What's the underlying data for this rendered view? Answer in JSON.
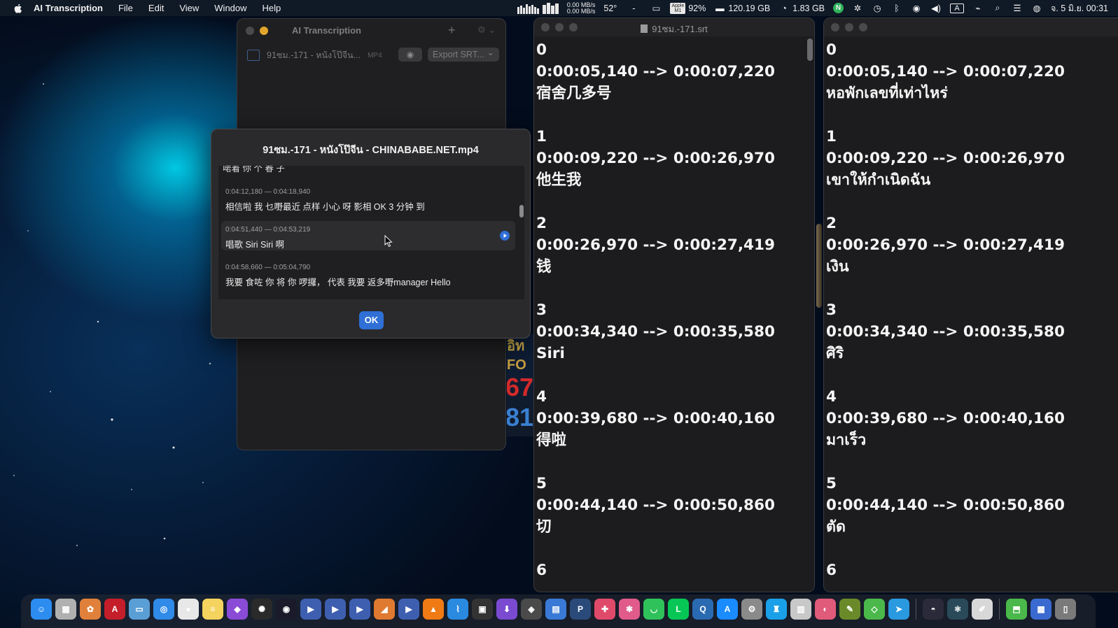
{
  "menubar": {
    "app_name": "AI Transcription",
    "menus": [
      "File",
      "Edit",
      "View",
      "Window",
      "Help"
    ],
    "net_up": "0.00 MB/s",
    "net_down": "0.00 MB/s",
    "temperature": "52°",
    "dash": "-",
    "chip_label_1": "Apple",
    "chip_label_2": "M1",
    "cpu_percent": "92%",
    "disk_free": "120.19 GB",
    "memory": "1.83 GB",
    "input_source": "A",
    "datetime": "จ. 5 มิ.ย.  00:31"
  },
  "main_window": {
    "title": "AI Transcription",
    "add_symbol": "+",
    "file_name": "91ซม.-171 - หนังโป๊จีน...",
    "file_type": "MP4",
    "export_label": "Export SRT...",
    "export_chevron": "⌄"
  },
  "dialog": {
    "title": "91ซม.-171 - หนังโป๊จีน - CHINABABE.NET.mp4",
    "cut_text": "啱着 你 个 春 子",
    "segments": [
      {
        "time": "0:04:12,180 — 0:04:18,940",
        "text": "相信啦 我 乜嘢最近 点样 小心 呀 影相 OK 3 分钟 到"
      },
      {
        "time": "0:04:51,440 — 0:04:53,219",
        "text": "唱歌 Siri Siri 啊"
      },
      {
        "time": "0:04:58,660 — 0:05:04,790",
        "text": "我要 食咗 你 将 你 啰攞， 代表 我要 返多嘢manager Hello"
      }
    ],
    "ok_label": "OK"
  },
  "behind_window": {
    "text_1": "อิท",
    "text_2": "FO",
    "text_3": "67",
    "text_4": "81"
  },
  "srt_left": {
    "title": "91ซม.-171.srt",
    "entries": [
      {
        "index": "0",
        "time": "0:00:05,140 --> 0:00:07,220",
        "text": "宿舍几多号"
      },
      {
        "index": "1",
        "time": "0:00:09,220 --> 0:00:26,970",
        "text": "他生我"
      },
      {
        "index": "2",
        "time": "0:00:26,970 --> 0:00:27,419",
        "text": "钱"
      },
      {
        "index": "3",
        "time": "0:00:34,340 --> 0:00:35,580",
        "text": "Siri"
      },
      {
        "index": "4",
        "time": "0:00:39,680 --> 0:00:40,160",
        "text": "得啦"
      },
      {
        "index": "5",
        "time": "0:00:44,140 --> 0:00:50,860",
        "text": "切"
      },
      {
        "index": "6",
        "time": "",
        "text": ""
      }
    ]
  },
  "srt_right": {
    "entries": [
      {
        "index": "0",
        "time": "0:00:05,140 --> 0:00:07,220",
        "text": "หอพักเลขที่เท่าไหร่"
      },
      {
        "index": "1",
        "time": "0:00:09,220 --> 0:00:26,970",
        "text": "เขาให้กำเนิดฉัน"
      },
      {
        "index": "2",
        "time": "0:00:26,970 --> 0:00:27,419",
        "text": "เงิน"
      },
      {
        "index": "3",
        "time": "0:00:34,340 --> 0:00:35,580",
        "text": "ศิริ"
      },
      {
        "index": "4",
        "time": "0:00:39,680 --> 0:00:40,160",
        "text": "มาเร็ว"
      },
      {
        "index": "5",
        "time": "0:00:44,140 --> 0:00:50,860",
        "text": "ตัด"
      },
      {
        "index": "6",
        "time": "",
        "text": ""
      }
    ]
  },
  "dock": {
    "apps": [
      {
        "name": "finder-icon",
        "color": "#2d8cf0",
        "glyph": "☺"
      },
      {
        "name": "launchpad-icon",
        "color": "#b0b0b0",
        "glyph": "▦"
      },
      {
        "name": "photos-icon",
        "color": "#e0803a",
        "glyph": "✿"
      },
      {
        "name": "adobe-icon",
        "color": "#c41e2a",
        "glyph": "A"
      },
      {
        "name": "preview-icon",
        "color": "#5a9ed6",
        "glyph": "▭"
      },
      {
        "name": "safari-icon",
        "color": "#2f8ae8",
        "glyph": "◎"
      },
      {
        "name": "chrome-icon",
        "color": "#e8e8e8",
        "glyph": "●"
      },
      {
        "name": "notes-icon",
        "color": "#f4d35e",
        "glyph": "≡"
      },
      {
        "name": "affinity-icon",
        "color": "#8a4bd6",
        "glyph": "◆"
      },
      {
        "name": "davinci-icon",
        "color": "#2a2a2a",
        "glyph": "✺"
      },
      {
        "name": "hitfilm-icon",
        "color": "#1a1a2a",
        "glyph": "◉"
      },
      {
        "name": "player-1-icon",
        "color": "#3e5fb0",
        "glyph": "▶"
      },
      {
        "name": "player-2-icon",
        "color": "#3e5fb0",
        "glyph": "▶"
      },
      {
        "name": "player-3-icon",
        "color": "#3e5fb0",
        "glyph": "▶"
      },
      {
        "name": "elmedia-icon",
        "color": "#e07a30",
        "glyph": "◢"
      },
      {
        "name": "player-4-icon",
        "color": "#3e5fb0",
        "glyph": "▶"
      },
      {
        "name": "vlc-icon",
        "color": "#f07a14",
        "glyph": "▲"
      },
      {
        "name": "vscode-icon",
        "color": "#2a8ae0",
        "glyph": "⌇"
      },
      {
        "name": "screen-capture-icon",
        "color": "#333",
        "glyph": "▣"
      },
      {
        "name": "downie-icon",
        "color": "#7a4ad0",
        "glyph": "⬇"
      },
      {
        "name": "gamepad-icon",
        "color": "#4a4a4a",
        "glyph": "◈"
      },
      {
        "name": "files-icon",
        "color": "#3a7ad6",
        "glyph": "▤"
      },
      {
        "name": "pro-app-icon",
        "color": "#2a4a7a",
        "glyph": "P"
      },
      {
        "name": "pixel-icon",
        "color": "#e04a6a",
        "glyph": "✚"
      },
      {
        "name": "color-icon",
        "color": "#e05a8a",
        "glyph": "✱"
      },
      {
        "name": "wechat-icon",
        "color": "#2fc25b",
        "glyph": "◡"
      },
      {
        "name": "line-icon",
        "color": "#06c755",
        "glyph": "L"
      },
      {
        "name": "quicktime-icon",
        "color": "#2a6ab0",
        "glyph": "Q"
      },
      {
        "name": "app-store-icon",
        "color": "#1a8cff",
        "glyph": "A"
      },
      {
        "name": "system-settings-icon",
        "color": "#8a8a8a",
        "glyph": "⚙"
      },
      {
        "name": "qq-icon",
        "color": "#1aa0e8",
        "glyph": "♜"
      },
      {
        "name": "archive-icon",
        "color": "#c8c8c8",
        "glyph": "▥"
      },
      {
        "name": "cleaner-icon",
        "color": "#e05a7a",
        "glyph": "◐"
      },
      {
        "name": "dropper-icon",
        "color": "#6a8a2a",
        "glyph": "✎"
      },
      {
        "name": "vpn-icon",
        "color": "#4ab84a",
        "glyph": "◇"
      },
      {
        "name": "telegram-icon",
        "color": "#2a9ae0",
        "glyph": "➤"
      },
      {
        "name": "github-icon",
        "color": "#2a2a3a",
        "glyph": "◓"
      },
      {
        "name": "electron-icon",
        "color": "#2a4a5a",
        "glyph": "⚛"
      },
      {
        "name": "editor-icon",
        "color": "#d8d8d8",
        "glyph": "✐"
      },
      {
        "name": "downloads-icon",
        "color": "#4ab84a",
        "glyph": "⬒"
      },
      {
        "name": "documents-icon",
        "color": "#3a6ad0",
        "glyph": "▦"
      },
      {
        "name": "trash-icon",
        "color": "#7a7a7a",
        "glyph": "▯"
      }
    ]
  },
  "colors": {
    "accent": "#2f6fd6",
    "window_bg": "#1f1f21",
    "srt_text": "#f5f5f5"
  }
}
